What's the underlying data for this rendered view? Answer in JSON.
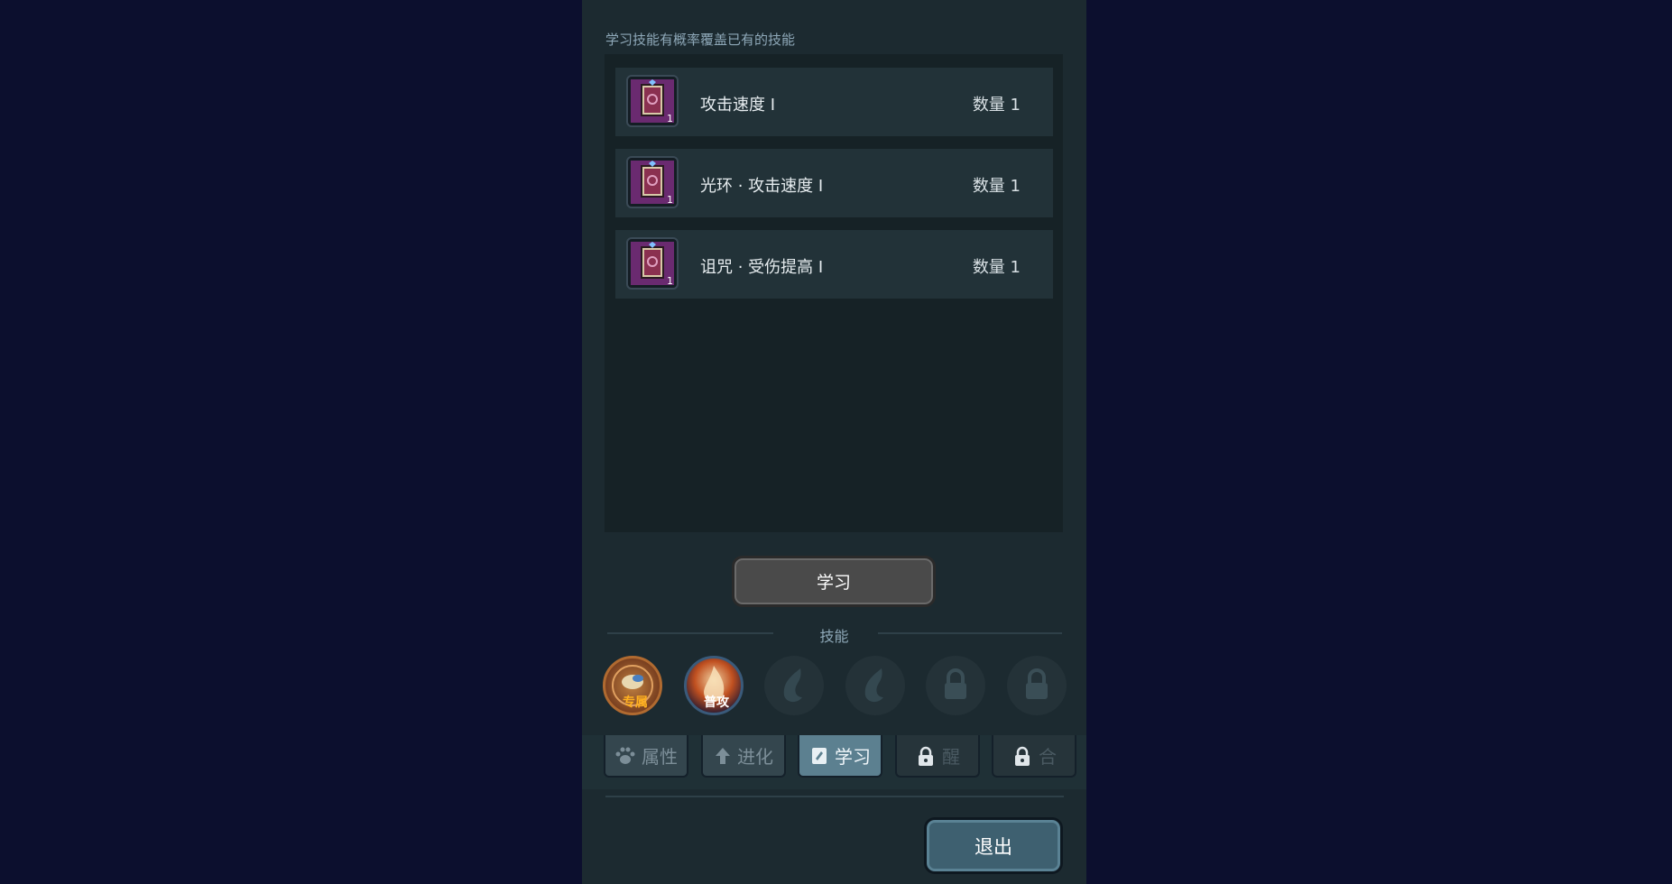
{
  "hint": "学习技能有概率覆盖已有的技能",
  "items": [
    {
      "name": "攻击速度 Ⅰ",
      "qty": "数量 1",
      "count": "1",
      "icon": "skill-book-icon"
    },
    {
      "name": "光环 · 攻击速度 Ⅰ",
      "qty": "数量 1",
      "count": "1",
      "icon": "skill-book-icon"
    },
    {
      "name": "诅咒 · 受伤提高 Ⅰ",
      "qty": "数量 1",
      "count": "1",
      "icon": "skill-book-icon"
    }
  ],
  "learn_button": "学习",
  "skills_section": {
    "title": "技能",
    "slots": [
      {
        "tag": "专属",
        "state": "exclusive"
      },
      {
        "tag": "普攻",
        "state": "normal-attack"
      },
      {
        "tag": "",
        "state": "empty"
      },
      {
        "tag": "",
        "state": "empty"
      },
      {
        "tag": "",
        "state": "locked"
      },
      {
        "tag": "",
        "state": "locked"
      }
    ]
  },
  "tabs": [
    {
      "label": "属性",
      "icon": "paw-icon",
      "state": "normal"
    },
    {
      "label": "进化",
      "icon": "arrow-up-icon",
      "state": "normal"
    },
    {
      "label": "学习",
      "icon": "book-icon",
      "state": "active"
    },
    {
      "label": "醒",
      "icon": "lock-icon",
      "state": "locked"
    },
    {
      "label": "合",
      "icon": "lock-icon",
      "state": "locked"
    }
  ],
  "exit_button": "退出",
  "colors": {
    "background": "#0c0f2e",
    "panel": "#1c2a30",
    "active_tab": "#5c8090",
    "book_purple": "#5a2a6a"
  }
}
